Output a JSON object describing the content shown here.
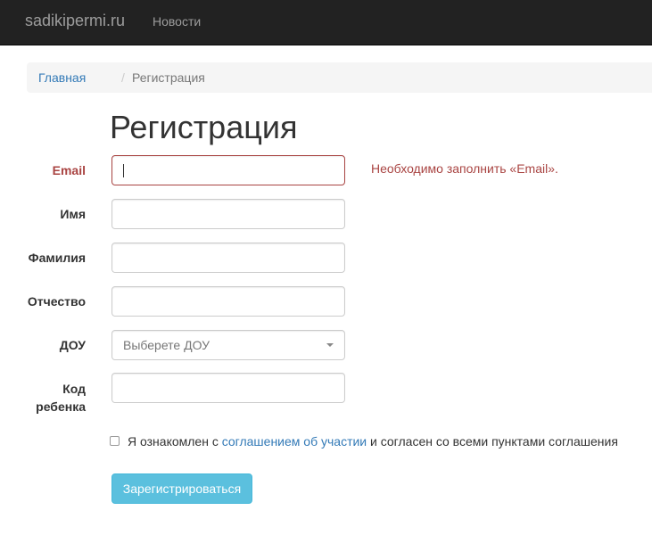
{
  "navbar": {
    "brand": "sadikipermi.ru",
    "links": [
      "Новости"
    ]
  },
  "breadcrumb": {
    "home": "Главная",
    "separator": "/",
    "current": "Регистрация"
  },
  "page": {
    "title": "Регистрация"
  },
  "form": {
    "email": {
      "label": "Email",
      "value": "",
      "error": "Необходимо заполнить «Email»."
    },
    "first_name": {
      "label": "Имя",
      "value": ""
    },
    "last_name": {
      "label": "Фамилия",
      "value": ""
    },
    "patronymic": {
      "label": "Отчество",
      "value": ""
    },
    "dou": {
      "label": "ДОУ",
      "placeholder": "Выберете ДОУ"
    },
    "child_code": {
      "label_line1": "Код",
      "label_line2": "ребенка",
      "value": ""
    },
    "agreement": {
      "checked": false,
      "text_before": "Я ознакомлен с ",
      "link_text": "соглашением об участии",
      "text_after": " и согласен со всеми пунктами соглашения"
    },
    "submit_label": "Зарегистрироваться"
  },
  "colors": {
    "navbar_bg": "#222222",
    "link": "#337ab7",
    "error": "#a94442",
    "button_bg": "#5bc0de"
  }
}
